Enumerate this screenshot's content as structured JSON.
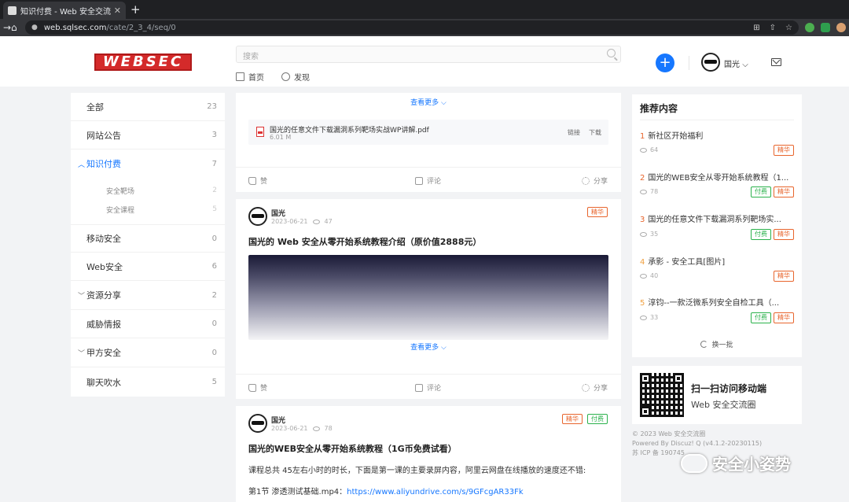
{
  "browser": {
    "tab_title": "知识付费 - Web 安全交流圈",
    "new_tab": "+",
    "close_tab": "✕",
    "url_host": "web.sqlsec.com",
    "url_path": "/cate/2_3_4/seq/0",
    "back": "←",
    "forward": "→",
    "reload": "⟳",
    "home": "⌂"
  },
  "header": {
    "logo": "WEBSEC",
    "search_placeholder": "搜索",
    "nav": [
      {
        "label": "首页",
        "icon": "home-icon"
      },
      {
        "label": "发现",
        "icon": "compass-icon"
      }
    ],
    "create_button": "+",
    "user_name": "国光"
  },
  "sidebar": {
    "categories": [
      {
        "label": "全部",
        "count": "23"
      },
      {
        "label": "网站公告",
        "count": "3"
      },
      {
        "label": "知识付费",
        "count": "7",
        "active": true,
        "expanded": true
      },
      {
        "label": "移动安全",
        "count": "0"
      },
      {
        "label": "Web安全",
        "count": "6"
      },
      {
        "label": "资源分享",
        "count": "2"
      },
      {
        "label": "威胁情报",
        "count": "0"
      },
      {
        "label": "甲方安全",
        "count": "0"
      },
      {
        "label": "聊天吹水",
        "count": "5"
      }
    ],
    "subcategories": [
      {
        "label": "安全靶场",
        "count": "2"
      },
      {
        "label": "安全课程",
        "count": "5"
      }
    ]
  },
  "feed": {
    "see_more": "查看更多",
    "actions": {
      "like": "赞",
      "comment": "评论",
      "share": "分享"
    },
    "attachment": {
      "name": "国光的任意文件下载漏洞系列靶场实战WP讲解.pdf",
      "size": "6.01 M",
      "link": "链接",
      "download": "下载"
    },
    "posts": [
      {
        "author": "国光",
        "date": "2023-06-21",
        "views": "47",
        "badges": [
          "精华"
        ],
        "title": "国光的 Web 安全从零开始系统教程介绍（原价值2888元）"
      },
      {
        "author": "国光",
        "date": "2023-06-21",
        "views": "78",
        "badges": [
          "精华",
          "付费"
        ],
        "title": "国光的WEB安全从零开始系统教程（1G币免费试看）",
        "body": "课程总共 45左右小时的时长，下面是第一课的主要录屏内容，阿里云网盘在线播放的速度还不错:",
        "episode_label": "第1节 渗透测试基础.mp4：",
        "episode_link": "https://www.aliyundrive.com/s/9GFcgAR33Fk"
      }
    ]
  },
  "recommend": {
    "title": "推荐内容",
    "refresh": "换一批",
    "items": [
      {
        "num": "1",
        "title": "新社区开始福利",
        "views": "64",
        "badges": [
          "精华"
        ]
      },
      {
        "num": "2",
        "title": "国光的WEB安全从零开始系统教程（1...",
        "views": "78",
        "badges": [
          "付费",
          "精华"
        ]
      },
      {
        "num": "3",
        "title": "国光的任意文件下载漏洞系列靶场实...",
        "views": "35",
        "badges": [
          "付费",
          "精华"
        ]
      },
      {
        "num": "4",
        "title": "承影 - 安全工具[图片]",
        "views": "40",
        "badges": [
          "精华"
        ]
      },
      {
        "num": "5",
        "title": "淳钧--一款泛微系列安全自检工具（...",
        "views": "33",
        "badges": [
          "付费",
          "精华"
        ]
      }
    ]
  },
  "qr": {
    "title": "扫一扫访问移动端",
    "subtitle": "Web 安全交流圈"
  },
  "footer": {
    "copyright": "© 2023 Web 安全交流圈",
    "powered": "Powered By Discuz! Q (v4.1.2-20230115)",
    "icp": "苏 ICP 备 190745"
  },
  "watermark": {
    "text": "安全小姿势"
  },
  "colors": {
    "accent": "#1677ff",
    "badge_jing": "#e8652d",
    "badge_fu": "#2bb24c",
    "logo": "#d42a2a"
  }
}
